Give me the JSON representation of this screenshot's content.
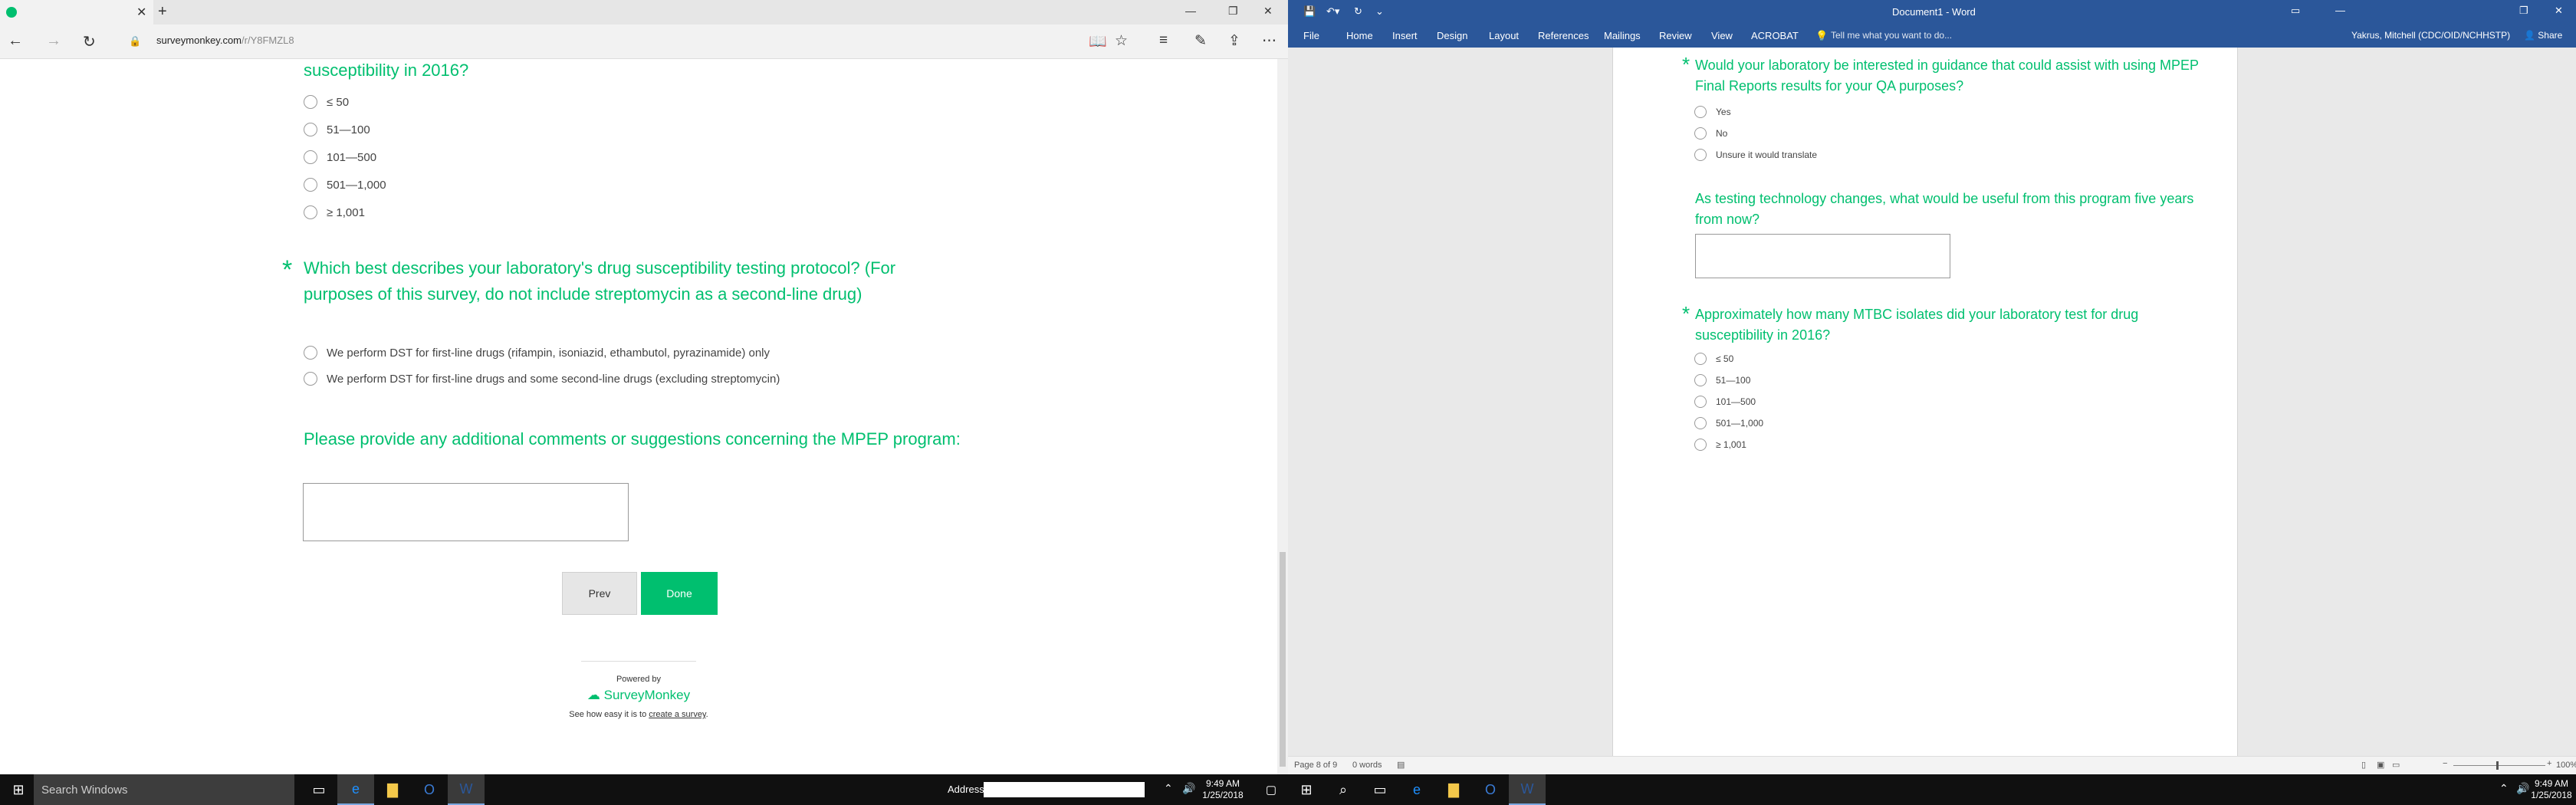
{
  "edge": {
    "tab_title": "",
    "url_domain": "surveymonkey.com",
    "url_path": "/r/Y8FMZL8",
    "content": {
      "q1_title_tail": "susceptibility in 2016?",
      "q1_options": [
        "≤ 50",
        "51—100",
        "101—500",
        "501—1,000",
        "≥ 1,001"
      ],
      "q2_star": "*",
      "q2_title": "Which best describes your laboratory's drug susceptibility testing protocol? (For purposes of this survey, do not include streptomycin as a second-line drug)",
      "q2_options": [
        "We perform DST for first-line drugs (rifampin, isoniazid, ethambutol, pyrazinamide) only",
        "We perform DST for first-line drugs and some second-line drugs (excluding streptomycin)"
      ],
      "q3_title": "Please provide any additional comments or suggestions concerning the MPEP program:",
      "prev_label": "Prev",
      "done_label": "Done",
      "powered_by": "Powered by",
      "brand": "SurveyMonkey",
      "cta_prefix": "See how easy it is to ",
      "cta_link": "create a survey",
      "cta_suffix": "."
    }
  },
  "word": {
    "title": "Document1 - Word",
    "user": "Yakrus, Mitchell (CDC/OID/NCHHSTP)",
    "share": "Share",
    "tell_me": "Tell me what you want to do...",
    "ribbon_tabs": [
      "File",
      "Home",
      "Insert",
      "Design",
      "Layout",
      "References",
      "Mailings",
      "Review",
      "View",
      "ACROBAT"
    ],
    "q1_star": "*",
    "q1_title": "Would your laboratory be interested in guidance that could assist with using MPEP Final Reports results for your QA purposes?",
    "q1_options": [
      "Yes",
      "No",
      "Unsure it would translate"
    ],
    "q2_title": "As testing technology changes, what would be useful from this program five years from now?",
    "q3_star": "*",
    "q3_title": "Approximately how many MTBC isolates did your laboratory test for drug susceptibility in 2016?",
    "q3_options": [
      "≤ 50",
      "51—100",
      "101—500",
      "501—1,000",
      "≥ 1,001"
    ],
    "status_page": "Page 8 of 9",
    "status_words": "0 words",
    "zoom": "100%"
  },
  "taskbar": {
    "search_placeholder": "Search Windows",
    "address_label": "Address",
    "time": "9:49 AM",
    "date": "1/25/2018"
  },
  "colors": {
    "accent": "#00bf6f",
    "word_blue": "#2b579a",
    "taskbar": "#101010"
  }
}
